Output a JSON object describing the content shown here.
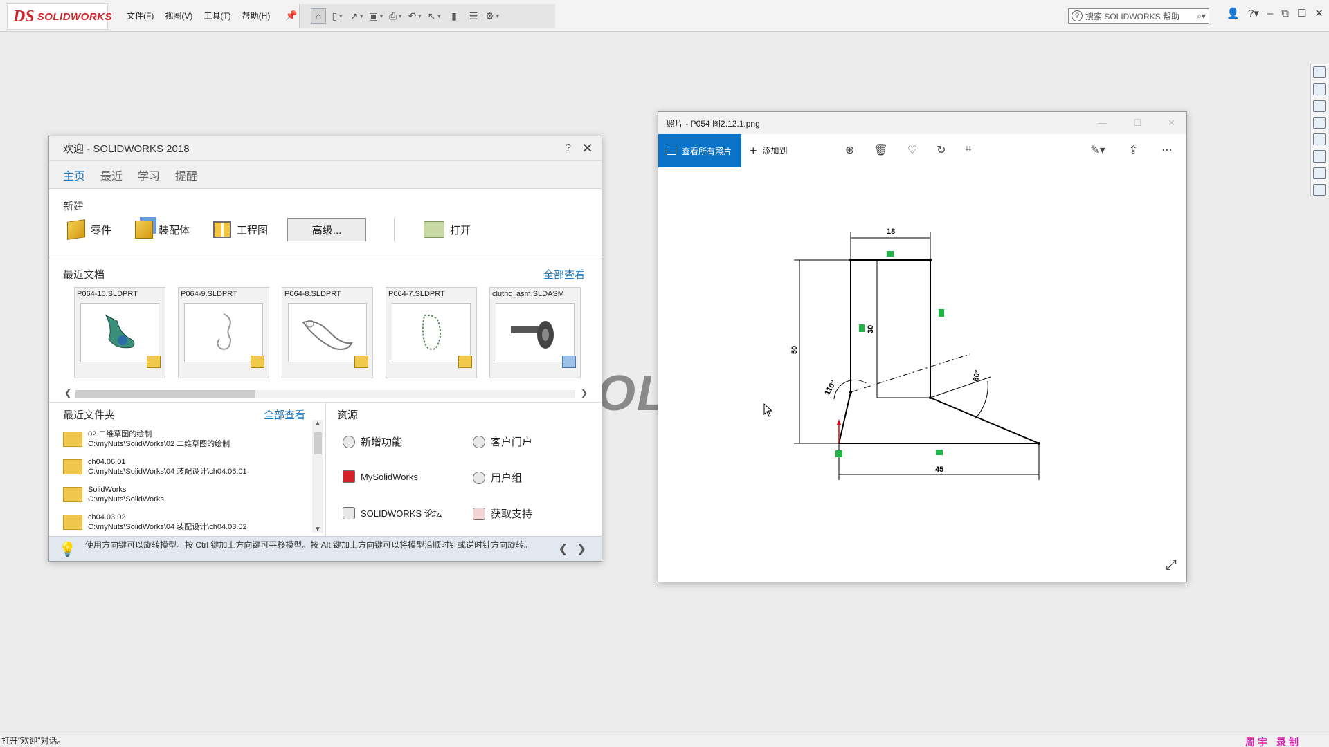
{
  "app": {
    "logo_ds": "DS",
    "logo_brand": "SOLIDWORKS",
    "menus": [
      "文件(F)",
      "视图(V)",
      "工具(T)",
      "帮助(H)"
    ],
    "search_placeholder": "搜索 SOLIDWORKS 帮助",
    "watermark": "OLI"
  },
  "welcome": {
    "title": "欢迎 - SOLIDWORKS 2018",
    "help": "?",
    "close": "✕",
    "tabs": [
      "主页",
      "最近",
      "学习",
      "提醒"
    ],
    "new_heading": "新建",
    "new_items": {
      "part": "零件",
      "assembly": "装配体",
      "drawing": "工程图",
      "advanced": "高级...",
      "open": "打开"
    },
    "recent_docs_heading": "最近文档",
    "recent_docs_viewall": "全部查看",
    "recent_docs": [
      "P064-10.SLDPRT",
      "P064-9.SLDPRT",
      "P064-8.SLDPRT",
      "P064-7.SLDPRT",
      "cluthc_asm.SLDASM"
    ],
    "recent_folders_heading": "最近文件夹",
    "recent_folders_viewall": "全部查看",
    "recent_folders": [
      {
        "name": "02 二维草图的绘制",
        "path": "C:\\myNuts\\SolidWorks\\02 二维草图的绘制"
      },
      {
        "name": "ch04.06.01",
        "path": "C:\\myNuts\\SolidWorks\\04 装配设计\\ch04.06.01"
      },
      {
        "name": "SolidWorks",
        "path": "C:\\myNuts\\SolidWorks"
      },
      {
        "name": "ch04.03.02",
        "path": "C:\\myNuts\\SolidWorks\\04 装配设计\\ch04.03.02"
      }
    ],
    "resources_heading": "资源",
    "resources": [
      "新增功能",
      "客户门户",
      "MySolidWorks",
      "用户组",
      "SOLIDWORKS 论坛",
      "获取支持"
    ],
    "tip": "使用方向键可以旋转模型。按 Ctrl 键加上方向键可平移模型。按 Alt 键加上方向键可以将模型沿顺时针或逆时针方向旋转。"
  },
  "photos": {
    "title": "照片 - P054 图2.12.1.png",
    "view_all": "查看所有照片",
    "add_to": "添加到",
    "drawing_dims": {
      "top_width": "18",
      "inner_height": "30",
      "total_height": "50",
      "bottom_width": "45",
      "angle_left": "110°",
      "angle_right": "60°"
    }
  },
  "status": {
    "text": "打开\"欢迎\"对话。",
    "author": "周宇 录制"
  },
  "colors": {
    "accent": "#0a73c7",
    "link": "#1f78c1",
    "brand_red": "#d2232a",
    "constraint_green": "#1fb545"
  }
}
